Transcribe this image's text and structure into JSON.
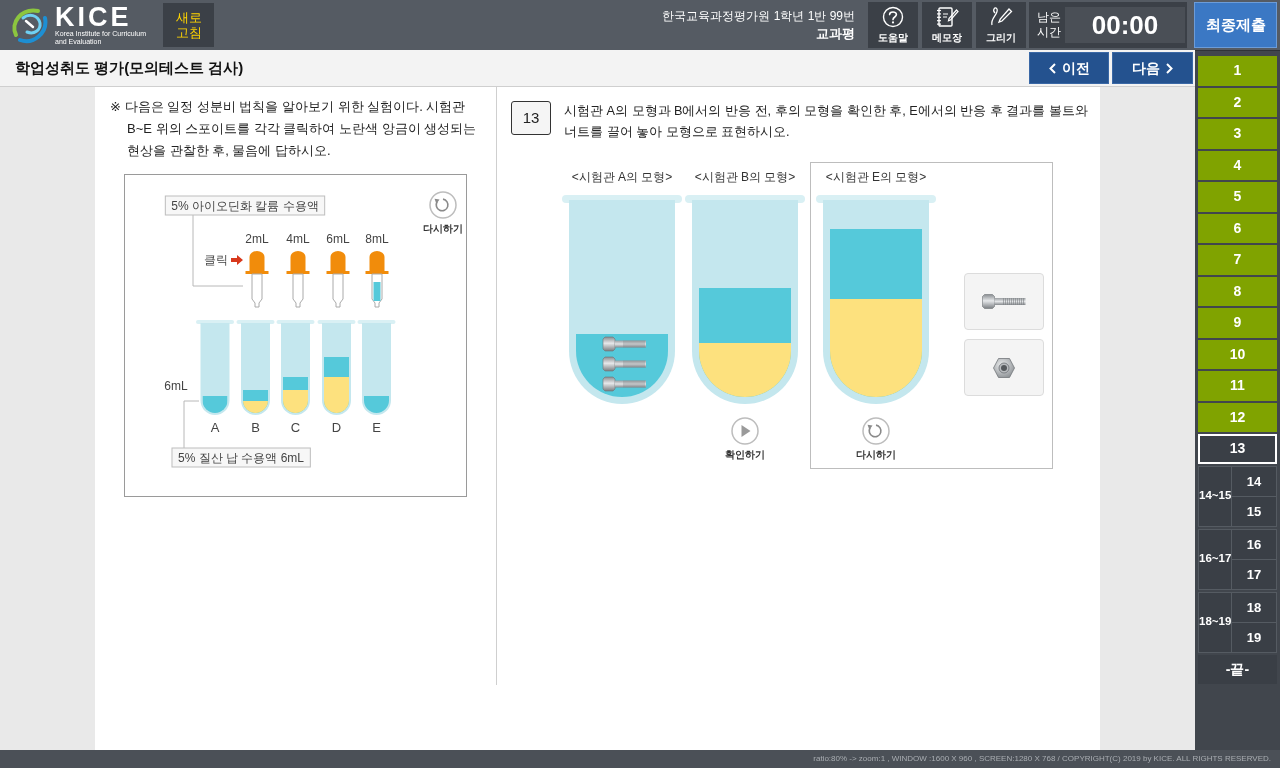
{
  "header": {
    "logo": {
      "name": "KICE",
      "subtitle": "Korea Institute for Curriculum and Evaluation"
    },
    "refresh_button": "새로 고침",
    "student": "한국교육과정평가원 1학년 1반 99번",
    "school": "교과평",
    "tools": [
      {
        "kind": "help",
        "label": "도움말"
      },
      {
        "kind": "memo",
        "label": "메모장"
      },
      {
        "kind": "draw",
        "label": "그리기"
      }
    ],
    "timer": {
      "label": "남은 시간",
      "value": "00:00"
    },
    "submit_button": "최종제출"
  },
  "title_bar": {
    "title": "학업성취도 평가(모의테스트 검사)",
    "prev_button": "이전",
    "next_button": "다음"
  },
  "passage": {
    "text": "※ 다음은 일정 성분비 법칙을 알아보기 위한 실험이다. 시험관 B~E 위의 스포이트를 각각 클릭하여 노란색 앙금이 생성되는 현상을 관찰한 후, 물음에 답하시오.",
    "experiment": {
      "reagent_label": "5% 아이오딘화 칼륨 수용액",
      "restart_button": "다시하기",
      "click_hint": "클릭",
      "droppers": [
        {
          "volume": "2mL",
          "used": true
        },
        {
          "volume": "4mL",
          "used": true
        },
        {
          "volume": "6mL",
          "used": true
        },
        {
          "volume": "8mL",
          "used": false
        }
      ],
      "volume_label": "6mL",
      "tubes": [
        {
          "label": "A"
        },
        {
          "label": "B"
        },
        {
          "label": "C"
        },
        {
          "label": "D"
        },
        {
          "label": "E"
        }
      ],
      "solution_label": "5% 질산 납 수용액 6mL"
    }
  },
  "question": {
    "number": "13",
    "text": "시험관 A의 모형과 B에서의 반응 전, 후의 모형을 확인한 후, E에서의 반응 후 결과를 볼트와 너트를 끌어 놓아 모형으로 표현하시오.",
    "models": [
      {
        "kind": "example",
        "label": "<시험관 A의 모형>"
      },
      {
        "kind": "demo",
        "label": "<시험관 B의 모형>",
        "button": {
          "kind": "play",
          "label": "확인하기"
        }
      },
      {
        "kind": "answer",
        "label": "<시험관 E의 모형>",
        "button": {
          "kind": "restart",
          "label": "다시하기"
        }
      }
    ]
  },
  "question_nav": [
    {
      "kind": "single",
      "label": "1",
      "answered": true,
      "selected": false
    },
    {
      "kind": "single",
      "label": "2",
      "answered": true,
      "selected": false
    },
    {
      "kind": "single",
      "label": "3",
      "answered": true,
      "selected": false
    },
    {
      "kind": "single",
      "label": "4",
      "answered": true,
      "selected": false
    },
    {
      "kind": "single",
      "label": "5",
      "answered": true,
      "selected": false
    },
    {
      "kind": "single",
      "label": "6",
      "answered": true,
      "selected": false
    },
    {
      "kind": "single",
      "label": "7",
      "answered": true,
      "selected": false
    },
    {
      "kind": "single",
      "label": "8",
      "answered": true,
      "selected": false
    },
    {
      "kind": "single",
      "label": "9",
      "answered": true,
      "selected": false
    },
    {
      "kind": "single",
      "label": "10",
      "answered": true,
      "selected": false
    },
    {
      "kind": "single",
      "label": "11",
      "answered": true,
      "selected": false
    },
    {
      "kind": "single",
      "label": "12",
      "answered": true,
      "selected": false
    },
    {
      "kind": "single",
      "label": "13",
      "answered": false,
      "selected": true
    },
    {
      "kind": "group",
      "label": "14~15",
      "items": [
        {
          "label": "14",
          "answered": false,
          "selected": false
        },
        {
          "label": "15",
          "answered": false,
          "selected": false
        }
      ]
    },
    {
      "kind": "group",
      "label": "16~17",
      "items": [
        {
          "label": "16",
          "answered": false,
          "selected": false
        },
        {
          "label": "17",
          "answered": false,
          "selected": false
        }
      ]
    },
    {
      "kind": "group",
      "label": "18~19",
      "items": [
        {
          "label": "18",
          "answered": false,
          "selected": false
        },
        {
          "label": "19",
          "answered": false,
          "selected": false
        }
      ]
    },
    {
      "kind": "end",
      "label": "-끝-"
    }
  ],
  "status_bar": "ratio:80% -> zoom:1 , WINDOW :1600 X 960 , SCREEN:1280 X 768 / COPYRIGHT(C) 2019 by KICE. ALL RIGHTS RESERVED."
}
